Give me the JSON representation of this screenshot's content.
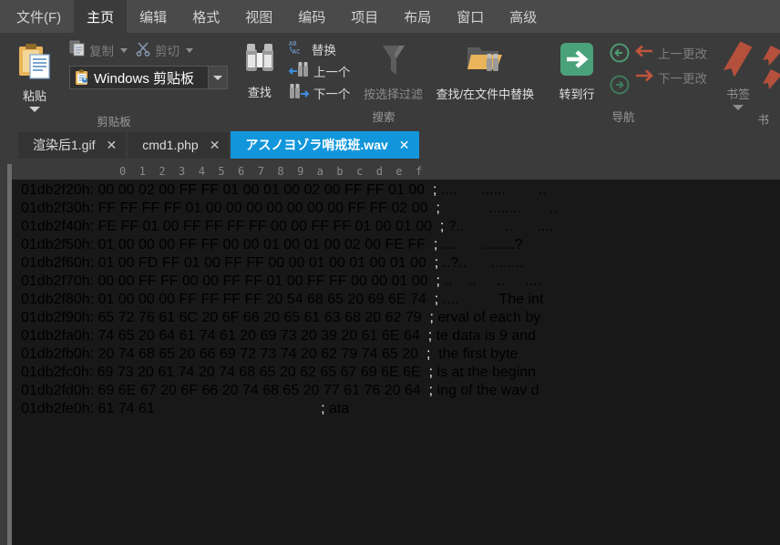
{
  "menubar": {
    "items": [
      {
        "label": "文件(F)",
        "active": false
      },
      {
        "label": "主页",
        "active": true
      },
      {
        "label": "编辑",
        "active": false
      },
      {
        "label": "格式",
        "active": false
      },
      {
        "label": "视图",
        "active": false
      },
      {
        "label": "编码",
        "active": false
      },
      {
        "label": "项目",
        "active": false
      },
      {
        "label": "布局",
        "active": false
      },
      {
        "label": "窗口",
        "active": false
      },
      {
        "label": "高级",
        "active": false
      }
    ]
  },
  "ribbon": {
    "clipboard": {
      "group_label": "剪贴板",
      "paste_label": "粘贴",
      "paste_icon": "clipboard-paste-icon",
      "copy_label": "复制",
      "copy_icon": "copy-icon",
      "cut_label": "剪切",
      "cut_icon": "scissors-icon",
      "combo_label": "Windows 剪贴板",
      "combo_icon": "clipboard-user-icon",
      "combo_arrow_icon": "chevron-down-icon"
    },
    "search": {
      "group_label": "搜索",
      "find_label": "查找",
      "find_icon": "binoculars-icon",
      "replace_label": "替换",
      "replace_icon": "ab-ac-replace-icon",
      "prev_label": "上一个",
      "prev_icon": "binoculars-left-arrow-icon",
      "next_label": "下一个",
      "next_icon": "binoculars-right-arrow-icon",
      "filter_label": "按选择过滤",
      "filter_icon": "funnel-icon",
      "findinfiles_label": "查找/在文件中替换",
      "findinfiles_icon": "folder-binoculars-icon"
    },
    "navigation": {
      "group_label": "导航",
      "goto_label": "转到行",
      "goto_icon": "green-arrow-right-icon",
      "back_icon": "circle-arrow-left-icon",
      "forward_icon": "circle-arrow-right-icon",
      "prev_change_label": "上一更改",
      "prev_change_icon": "arrow-left-icon",
      "next_change_label": "下一更改",
      "next_change_icon": "arrow-right-icon"
    },
    "bookmark": {
      "group_label": "书",
      "label": "书签",
      "icon": "bookmark-ribbon-icon",
      "caret_icon": "caret-down-icon"
    }
  },
  "tabs": [
    {
      "label": "渲染后1.gif",
      "active": false,
      "close_icon": "close-icon"
    },
    {
      "label": "cmd1.php",
      "active": false,
      "close_icon": "close-icon"
    },
    {
      "label": "アスノヨゾラ哨戒班.wav",
      "active": true,
      "close_icon": "close-icon"
    }
  ],
  "hex": {
    "ruler": "0  1  2  3  4  5  6  7  8  9  a  b  c  d  e  f",
    "separator": ";",
    "selected_row_index": 13,
    "cursor_byte_index": 2,
    "rows": [
      {
        "offset": "01db2f20h:",
        "bytes": "00 00 02 00 FF FF 01 00 01 00 02 00 FF FF 01 00",
        "ascii": "....      ......        .."
      },
      {
        "offset": "01db2f30h:",
        "bytes": "FF FF FF FF 01 00 00 00 00 00 00 00 FF FF 02 00",
        "ascii": "           ........       .."
      },
      {
        "offset": "01db2f40h:",
        "bytes": "FE FF 01 00 FF FF FF FF 00 00 FF FF 01 00 01 00",
        "ascii": "?..          ..      ...."
      },
      {
        "offset": "01db2f50h:",
        "bytes": "01 00 00 00 FF FF 00 00 01 00 01 00 02 00 FE FF",
        "ascii": "....      ........?"
      },
      {
        "offset": "01db2f60h:",
        "bytes": "01 00 FD FF 01 00 FF FF 00 00 01 00 01 00 01 00",
        "ascii": "..?..      ........"
      },
      {
        "offset": "01db2f70h:",
        "bytes": "00 00 FF FF 00 00 FF FF 01 00 FF FF 00 00 01 00",
        "ascii": "..    ..     ..     ...."
      },
      {
        "offset": "01db2f80h:",
        "bytes": "01 00 00 00 FF FF FF FF 20 54 68 65 20 69 6E 74",
        "ascii": "....          The int"
      },
      {
        "offset": "01db2f90h:",
        "bytes": "65 72 76 61 6C 20 6F 66 20 65 61 63 68 20 62 79",
        "ascii": "erval of each by"
      },
      {
        "offset": "01db2fa0h:",
        "bytes": "74 65 20 64 61 74 61 20 69 73 20 39 20 61 6E 64",
        "ascii": "te data is 9 and"
      },
      {
        "offset": "01db2fb0h:",
        "bytes": "20 74 68 65 20 66 69 72 73 74 20 62 79 74 65 20",
        "ascii": " the first byte"
      },
      {
        "offset": "01db2fc0h:",
        "bytes": "69 73 20 61 74 20 74 68 65 20 62 65 67 69 6E 6E",
        "ascii": "is at the beginn"
      },
      {
        "offset": "01db2fd0h:",
        "bytes": "69 6E 67 20 6F 66 20 74 68 65 20 77 61 76 20 64",
        "ascii": "ing of the wav d"
      },
      {
        "offset": "01db2fe0h:",
        "bytes": "61 74 61",
        "ascii": "ata"
      }
    ]
  },
  "colors": {
    "menubar_bg": "#4a4a4a",
    "ribbon_bg": "#3b3b3b",
    "hex_bg": "#181818",
    "active_tab": "#1296db",
    "selection": "#11506b",
    "cursor": "#0a8fd8",
    "goto_green": "#4aa27a",
    "bookmark_red": "#b4503c"
  }
}
